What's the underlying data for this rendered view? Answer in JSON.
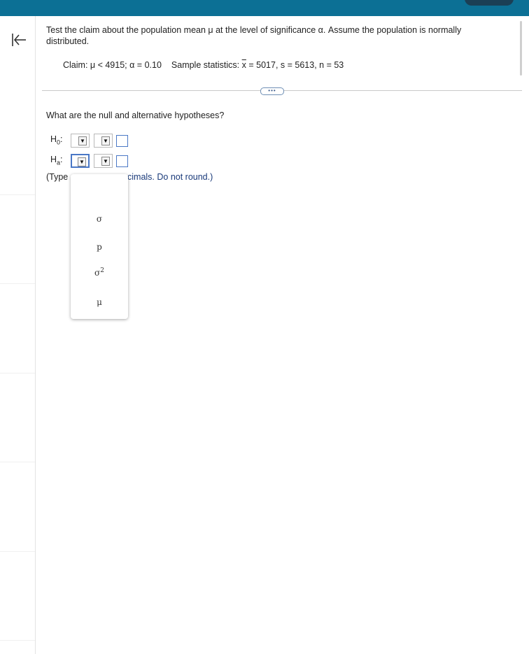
{
  "header": {
    "accent_color": "#0c7095"
  },
  "nav": {
    "collapse_icon": "collapse-left-icon"
  },
  "problem": {
    "intro": "Test the claim about the population mean μ at the level of significance α. Assume the population is normally distributed.",
    "claim": "Claim: μ < 4915; α = 0.10",
    "sample_prefix": "Sample statistics: ",
    "sample_xbar_symbol": "x",
    "sample_rest": " = 5017, s = 5613, n = 53"
  },
  "more_button_label": "•••",
  "question": "What are the null and alternative hypotheses?",
  "hypotheses": {
    "h0": {
      "label_main": "H",
      "label_sub": "0",
      "label_colon": ":"
    },
    "ha": {
      "label_main": "H",
      "label_sub": "a",
      "label_colon": ":"
    }
  },
  "dropdown_arrow": "▼",
  "type_hint": {
    "prefix": "(Type",
    "suffix": "cimals. Do not round.)"
  },
  "dropdown_options": [
    {
      "symbol": "σ",
      "sup": ""
    },
    {
      "symbol": "p",
      "sup": ""
    },
    {
      "symbol": "σ",
      "sup": "2"
    },
    {
      "symbol": "μ",
      "sup": ""
    }
  ]
}
